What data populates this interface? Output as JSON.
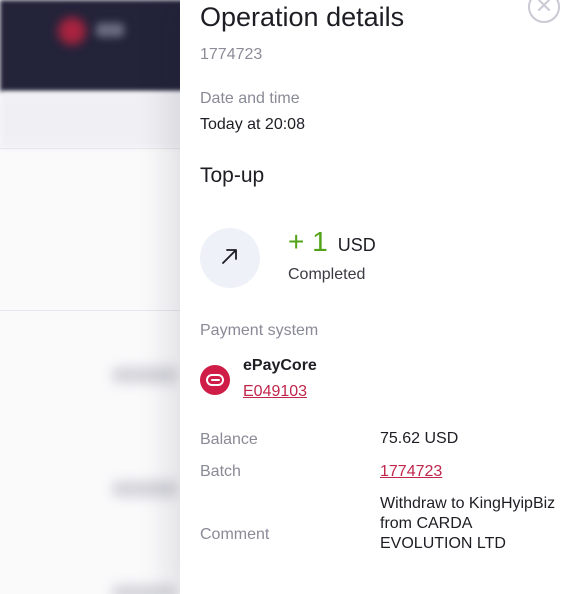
{
  "details": {
    "title": "Operation details",
    "operation_id": "1774723",
    "date_label": "Date and time",
    "date_value": "Today at 20:08",
    "type": "Top-up",
    "amount": "+ 1",
    "currency": "USD",
    "status": "Completed",
    "payment_system_label": "Payment system",
    "payment_system_name": "ePayCore",
    "payment_account": "E049103",
    "balance_label": "Balance",
    "balance_value": "75.62 USD",
    "batch_label": "Batch",
    "batch_value": "1774723",
    "comment_label": "Comment",
    "comment_value": "Withdraw to KingHyipBiz from CARDA EVOLUTION LTD"
  },
  "icons": {
    "close": "close-icon",
    "direction": "arrow-up-right-icon",
    "payment_logo": "epaycore-logo"
  },
  "colors": {
    "amount_positive": "#53a318",
    "link": "#c0264a",
    "payment_logo_bg": "#cf1d47",
    "muted_text": "#8a8a97"
  }
}
